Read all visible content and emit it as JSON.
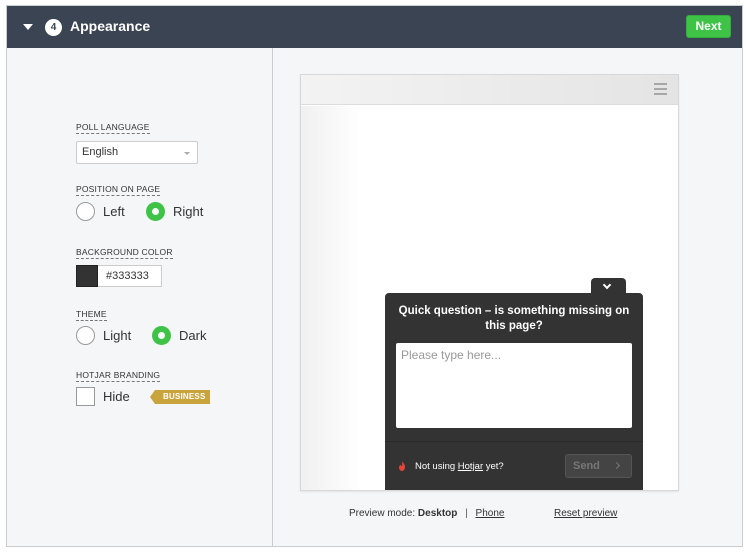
{
  "header": {
    "step_number": "4",
    "title": "Appearance",
    "next_label": "Next"
  },
  "settings": {
    "poll_language": {
      "label": "Poll Language",
      "selected": "English"
    },
    "position": {
      "label": "Position on page",
      "options": [
        "Left",
        "Right"
      ],
      "selected": "Right"
    },
    "background_color": {
      "label": "Background color",
      "value": "#333333"
    },
    "theme": {
      "label": "Theme",
      "options": [
        "Light",
        "Dark"
      ],
      "selected": "Dark"
    },
    "branding": {
      "label": "Hotjar Branding",
      "checkbox_label": "Hide",
      "checked": false,
      "badge": "BUSINESS"
    }
  },
  "preview": {
    "question": "Quick question – is something missing on this page?",
    "placeholder": "Please type here...",
    "footer_prefix": "Not using ",
    "footer_link": "Hotjar",
    "footer_suffix": " yet?",
    "send_label": "Send",
    "mode_label": "Preview mode:",
    "mode_desktop": "Desktop",
    "mode_separator": "|",
    "mode_phone": "Phone",
    "reset_label": "Reset preview"
  },
  "colors": {
    "header_bg": "#3b4452",
    "accent_green": "#3ec347",
    "poll_bg": "#333333",
    "badge_gold": "#c9a33c"
  }
}
